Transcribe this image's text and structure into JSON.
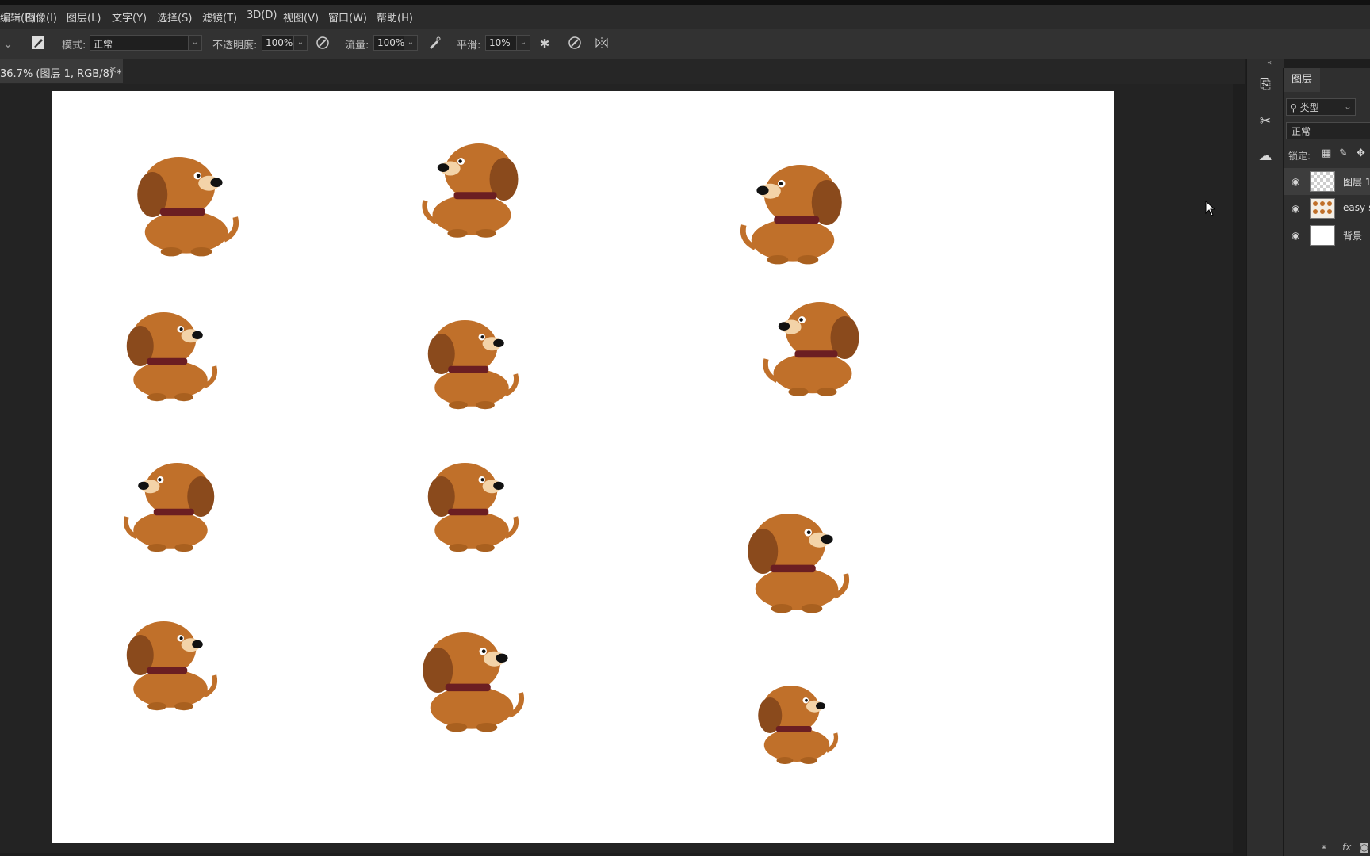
{
  "menubar": {
    "items": [
      "编辑(E)",
      "图像(I)",
      "图层(L)",
      "文字(Y)",
      "选择(S)",
      "滤镜(T)",
      "3D(D)",
      "视图(V)",
      "窗口(W)",
      "帮助(H)"
    ]
  },
  "options": {
    "mode_label": "模式:",
    "mode_value": "正常",
    "opacity_label": "不透明度:",
    "opacity_value": "100%",
    "flow_label": "流量:",
    "flow_value": "100%",
    "smooth_label": "平滑:",
    "smooth_value": "10%"
  },
  "document": {
    "tab_label": "36.7% (图层 1, RGB/8) *",
    "close_glyph": "×"
  },
  "layers_panel": {
    "tab": "图层",
    "filter": "类型",
    "blend_mode": "正常",
    "lock_label": "锁定:",
    "layers": [
      {
        "name": "图层 1",
        "thumb": "checker",
        "selected": true
      },
      {
        "name": "easy-s",
        "thumb": "dogs",
        "selected": false
      },
      {
        "name": "背景",
        "thumb": "white",
        "selected": false
      }
    ],
    "footer_fx": "fx"
  },
  "colors": {
    "dog_body": "#c0702a",
    "dog_dark": "#8a4a1c",
    "collar": "#6b1e22"
  },
  "icons": [
    "brush-tool-icon",
    "airbrush-icon",
    "pressure-opacity-icon",
    "pressure-size-icon",
    "settings-gear-icon",
    "symmetry-icon",
    "eye-icon",
    "lock-icon",
    "search-icon",
    "mouse-cursor-icon"
  ]
}
